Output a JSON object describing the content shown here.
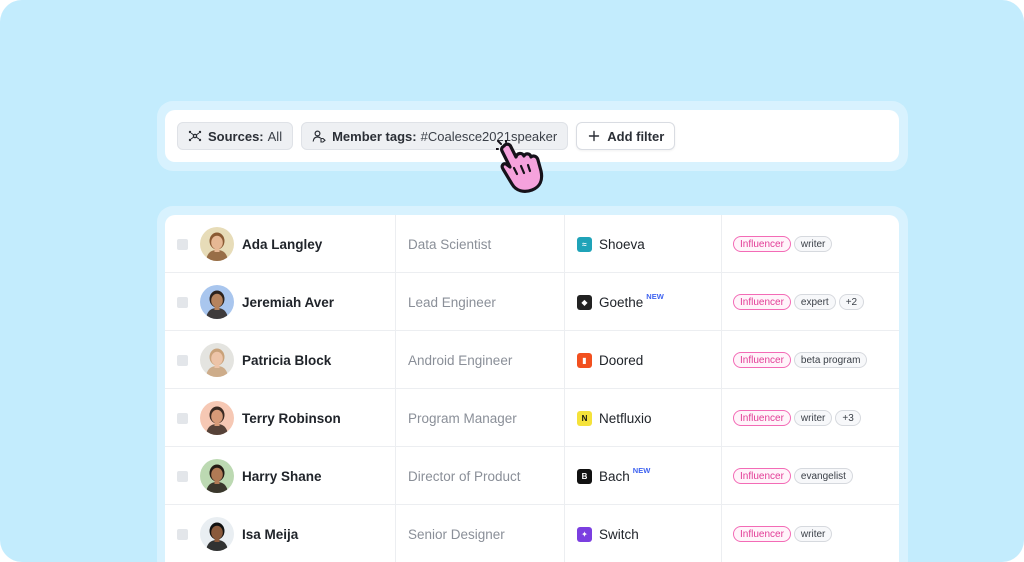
{
  "filters": {
    "sources": {
      "label": "Sources:",
      "value": "All",
      "icon": "sources-icon"
    },
    "member_tags": {
      "label": "Member tags:",
      "value": "#Coalesce2021speaker",
      "icon": "member-tags-icon"
    },
    "add_filter": {
      "label": "Add filter",
      "icon": "plus-icon"
    }
  },
  "members": [
    {
      "name": "Ada Langley",
      "role": "Data Scientist",
      "org": "Shoeva",
      "org_logo_color": "#1fa3b8",
      "org_logo_glyph": "≈",
      "is_new": false,
      "new_label": "",
      "tags": [
        "Influencer",
        "writer"
      ],
      "avatar_bg": "#e7dcb8",
      "avatar_skin": "#e6b894",
      "avatar_hair": "#8a5a33"
    },
    {
      "name": "Jeremiah Aver",
      "role": "Lead Engineer",
      "org": "Goethe",
      "org_logo_color": "#222222",
      "org_logo_glyph": "◆",
      "is_new": true,
      "new_label": "NEW",
      "tags": [
        "Influencer",
        "expert",
        "+2"
      ],
      "avatar_bg": "#a9c6ee",
      "avatar_skin": "#b6835d",
      "avatar_hair": "#2c221c"
    },
    {
      "name": "Patricia Block",
      "role": "Android Engineer",
      "org": "Doored",
      "org_logo_color": "#f2501f",
      "org_logo_glyph": "▮",
      "is_new": false,
      "new_label": "",
      "tags": [
        "Influencer",
        "beta program"
      ],
      "avatar_bg": "#e4e4e0",
      "avatar_skin": "#edc4a8",
      "avatar_hair": "#c9a27a"
    },
    {
      "name": "Terry Robinson",
      "role": "Program Manager",
      "org": "Netfluxio",
      "org_logo_color": "#f5e23a",
      "org_logo_glyph": "N",
      "is_new": false,
      "new_label": "",
      "tags": [
        "Influencer",
        "writer",
        "+3"
      ],
      "avatar_bg": "#f6c8b4",
      "avatar_skin": "#d69a78",
      "avatar_hair": "#3a2a22"
    },
    {
      "name": "Harry Shane",
      "role": "Director of Product",
      "org": "Bach",
      "org_logo_color": "#111111",
      "org_logo_glyph": "B",
      "is_new": true,
      "new_label": "NEW",
      "tags": [
        "Influencer",
        "evangelist"
      ],
      "avatar_bg": "#bcd9b2",
      "avatar_skin": "#b07a55",
      "avatar_hair": "#231a14"
    },
    {
      "name": "Isa Meija",
      "role": "Senior Designer",
      "org": "Switch",
      "org_logo_color": "#7b3fe0",
      "org_logo_glyph": "✦",
      "is_new": false,
      "new_label": "",
      "tags": [
        "Influencer",
        "writer"
      ],
      "avatar_bg": "#e9eef2",
      "avatar_skin": "#8a5a3c",
      "avatar_hair": "#111111"
    }
  ]
}
